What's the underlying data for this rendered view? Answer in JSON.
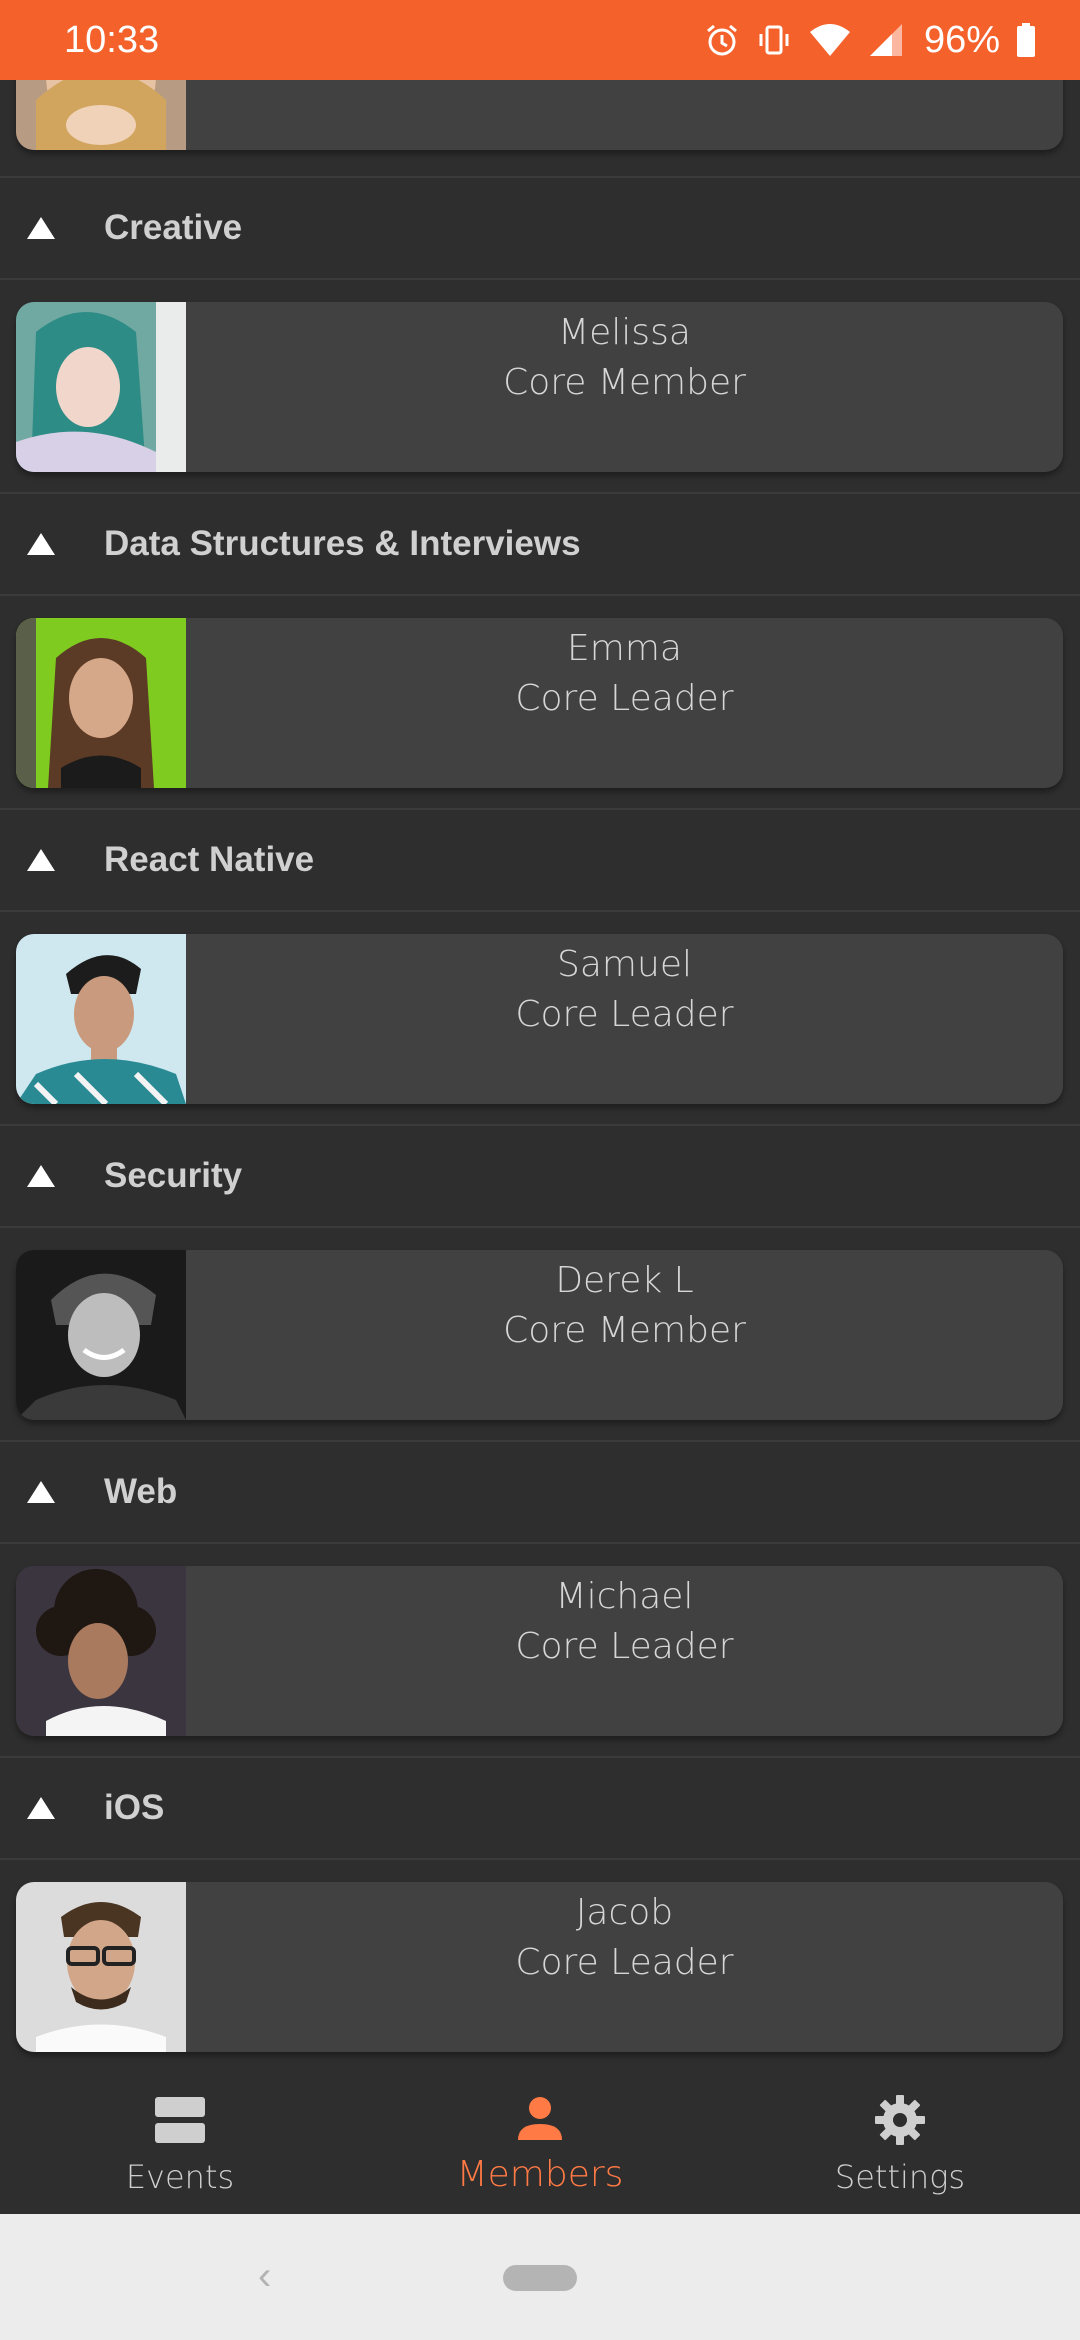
{
  "status_bar": {
    "time": "10:33",
    "battery": "96%",
    "icons": [
      "alarm-icon",
      "vibrate-icon",
      "wifi-icon",
      "signal-icon",
      "battery-icon"
    ],
    "color": "#f5612b"
  },
  "sections": [
    {
      "title": "Creative",
      "member": {
        "name": "Melissa",
        "role": "Core Member"
      }
    },
    {
      "title": "Data Structures & Interviews",
      "member": {
        "name": "Emma",
        "role": "Core Leader"
      }
    },
    {
      "title": "React Native",
      "member": {
        "name": "Samuel",
        "role": "Core Leader"
      }
    },
    {
      "title": "Security",
      "member": {
        "name": "Derek L",
        "role": "Core Member"
      }
    },
    {
      "title": "Web",
      "member": {
        "name": "Michael",
        "role": "Core Leader"
      }
    },
    {
      "title": "iOS",
      "member": {
        "name": "Jacob",
        "role": "Core Leader"
      }
    }
  ],
  "bottom_nav": {
    "items": [
      {
        "label": "Events",
        "icon": "events-icon"
      },
      {
        "label": "Members",
        "icon": "person-icon",
        "active": true
      },
      {
        "label": "Settings",
        "icon": "gear-icon"
      }
    ],
    "active_color": "#ff7a45"
  },
  "system_nav": {
    "back_glyph": "‹"
  }
}
